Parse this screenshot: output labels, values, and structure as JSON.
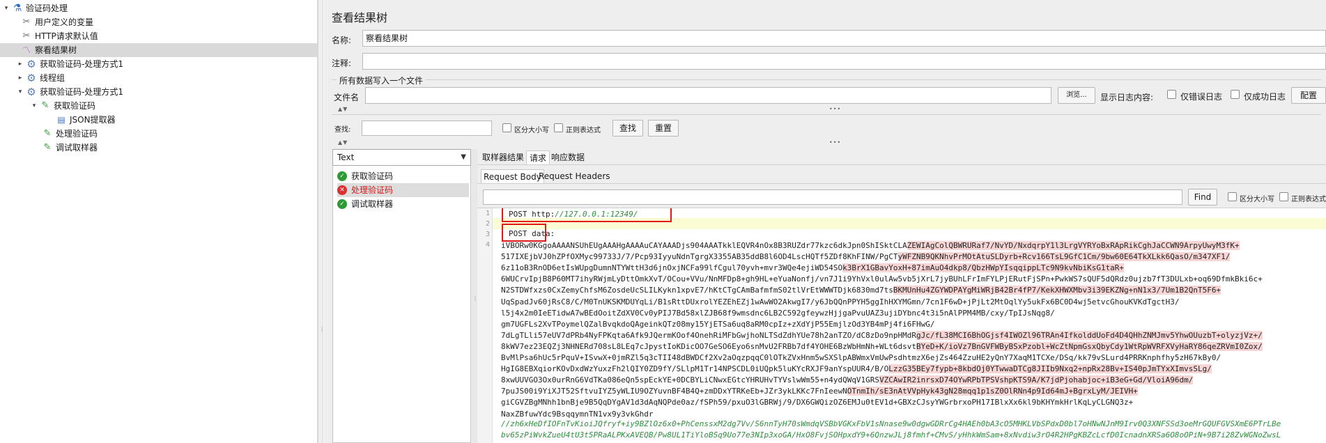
{
  "tree": {
    "items": [
      {
        "label": "验证码处理",
        "icon": "flask-icon",
        "expander": "▾"
      },
      {
        "label": "用户定义的变量",
        "icon": "wrench-icon",
        "expander": ""
      },
      {
        "label": "HTTP请求默认值",
        "icon": "wrench-icon",
        "expander": ""
      },
      {
        "label": "察看结果树",
        "icon": "chart-icon",
        "expander": ""
      },
      {
        "label": "获取验证码-处理方式1",
        "icon": "gear-icon",
        "expander": "▸"
      },
      {
        "label": "线程组",
        "icon": "gear-icon",
        "expander": "▸"
      },
      {
        "label": "获取验证码-处理方式1",
        "icon": "gear-icon",
        "expander": "▾"
      },
      {
        "label": "获取验证码",
        "icon": "pen-icon",
        "expander": "▾"
      },
      {
        "label": "JSON提取器",
        "icon": "doc-icon",
        "expander": ""
      },
      {
        "label": "处理验证码",
        "icon": "pen-icon",
        "expander": ""
      },
      {
        "label": "调试取样器",
        "icon": "pen-icon",
        "expander": ""
      }
    ]
  },
  "panel": {
    "title": "查看结果树",
    "name_label": "名称:",
    "name_value": "察看结果树",
    "comment_label": "注释:",
    "comment_value": "",
    "section_label": "所有数据写入一个文件",
    "file_label": "文件名",
    "file_value": "",
    "browse_label": "浏览...",
    "log_label": "显示日志内容:",
    "errors_only_label": "仅错误日志",
    "success_only_label": "仅成功日志",
    "config_label": "配置"
  },
  "search": {
    "label": "查找:",
    "value": "",
    "case_label": "区分大小写",
    "regex_label": "正则表达式",
    "find_label": "查找",
    "reset_label": "重置"
  },
  "renderer": {
    "selected": "Text"
  },
  "results": [
    {
      "label": "获取验证码",
      "status": "ok"
    },
    {
      "label": "处理验证码",
      "status": "error"
    },
    {
      "label": "调试取样器",
      "status": "ok"
    }
  ],
  "tabs": {
    "sampler": "取样器结果",
    "request": "请求",
    "response": "响应数据",
    "request_body": "Request Body",
    "request_headers": "Request Headers"
  },
  "code_search": {
    "value": "",
    "find_label": "Find",
    "case_label": "区分大小写",
    "regex_label": "正则表达式"
  },
  "code": {
    "line_numbers": [
      "1",
      "2",
      "3",
      "4"
    ],
    "line1_prefix": "POST http:",
    "line1_url": "//127.0.0.1:12349/",
    "line3": "POST data:",
    "body": [
      "iVBORw0KGgoAAAANSUhEUgAAAHgAAAAuCAYAAADjs904AAATkklEQVR4nOx8B3RUZdr77kzc6dkJpn0ShISktCLAZEWIAgColQBWRURaf7/NvYD/NxdqrpY1l3LrgVYRYoBxRApRikCghJaCCWN9ArpyUwyM3fK+",
      "517IXEjbVJ0hZPfOXMyc99733J/7/Pcp93IyyuNdnTgrgX3355AB35ddB8l6OD4LscHQTf5ZDf8KhFINW/PgCTyWFZNB9QKNhvPrMOtAtuSLDyrb+Rcv166TsL9GfC1Cm/9bw60E64TkXLkk6QasO/m347XF1/",
      "6z11oB3RnOD6etIsWUpgDumnNTYWttH3d6jnOxjNCFa99lfCgul70yvh+mvr3WQe4ejiWD54SOk3BrX1GBavYoxH+87imAuO4dkp8/QbzHWpYIsqqippLTc9N9kvNbiKsG1taR+",
      "6WUCrvIpjB8P60MT7ihyRWjmLyDttOmkXvT/OCou+VVu/NnMFDp8+gh9HL+eYuaNonfj/vn7J1i9YhVxl0ulAw5vb5jXrL7jyBUhLFrImFYLPjERutFjSPn+PwkWS7sQUF5dQRdz0ujzb7fT3DULxb+oq69DfmkBki6c+",
      "N2STDWfxzs0CxZemyChfsM6ZosdeUcSLILKykn1xpvE7/hKtCTgCAmBafmfmS02tlVrEtWWWTDjk6830md7tsBKMUnHu4ZGYWDPAYgMiWRjB42Br4fP7/KekXHWXMbv3i39EKZNg+nN1x3/7Um1B2QnT5F6+",
      "UqSpadJv60jRsC8/C/M0TnUKSKMDUYqLi/B1sRttDUxrolYEZEhEZj1wAwWO2AkwgI7/y6JbQQnPPYH5ggIhHXYMGmn/7cn1F6wD+jPjLt2MtOqlYy5ukFx6BC0D4wj5etvcGhouKVKdTgctH3/",
      "l5j4x2m0IeETidwA7wBEdOoitZdXV0Cv0yPIJ7Bd58xlZJB68f9wmsdnc6LB2C592gfeywzHjjgaPvuUAZ3ujiDYbnc4t3i5nAlPPM4MB/cxy/TpIJsNqg8/",
      "gm7UGFLs2XvTPoymelQZalBvqkdoQAgeinkQTz08my15YjETSa6uq8aRM0cpIz+zXdYjP55EmjlzOd3YB4mPj4fi6FHwG/",
      "7dLgTLli57eUV7dPRb4NyFPKqta6Afk9JQermKOof4OnehRiMFbGwjhoNLTSdZdhYUe78h2anTZO/dC8zDo9npHMdRgJc/fL38MCI6BhOGjsf4IWOZl96TRAn4IfkolddUoFd4D4QHhZNMJmv5YhwOUuzbT+olyzjVz+/",
      "8kWV7ez23EQZj3NHNERd708sL8LEq7cJpystIoKDicOO7GeSO6Eyo6snMvU2FRBb7df4YOHE6BzWbHmNh+WLt6dsvtBYeD+K/ioVz7BnGVFWByBSxPzobl+WcZtNpmGsxQbyCdy1WtRpWVRFXVyHaRY86qeZRVmI0Zox/",
      "BvMlPsa6hUc5rPquV+ISvwX+0jmRZl5q3cTII48dBWDCf2Xv2aOqzpqqC0lOTkZVxHnm5wSXSlpABWmxVmUwPsdhtmzX6ejZs464ZzuHE2yQnY7XaqM1TCXe/DSq/kk79vSLurd4PRRKnphfhy5zH67kBy0/",
      "HgIG8EBXqiorKOvDxdWzYuxzFh2lQIY0ZD9fY/SLlpM1Tr14NPSCDL0iUQpk5luKYcRXJF9anYspUUR4/B/OLzzG35BEy7fypb+8kbdOj0YTwwaDTCg8JIIb9Nxq2+npRx28Bv+IS40pJmTYxXImvsSLg/",
      "8xwUUVGO3Ox0urRnG6VdTKa086eQn5spEckYE+0DCBYLiCNwxEGtcYHRUHvTYVslwWm55+n4ydQWqV1GRSVZCAwIR2inrsxD74OYwRPbTPSVshpKTS9A/K7jdPjohabjoc+iB3eG+Gd/VloiA96dm/",
      "7puJS00i9YiXJT52SftvuIYZ5yWLIU9OZYuvnBF4B4Q+zmDDxYTRKeEb+JZr3ykLKKc7FnIeewNOTnmIh/sE3nAtVVpHyk43gN28mqq1p1sZ0OlRNn4p9Id64mJ+BgrxLyM/JEIVH+",
      "giCGVZBgMNhh1bnBje9B5QqDYgAV1d3dAqNQPde0az/fSPh59/pxuO3lGBRWj/9/DX6GWQizOZ6EMJu0tEV1d+GBXzCJsyYWGrbrxoPH17IBlxXx6kl9bKHYmkHrlKqLyCLGNQ3z+",
      "NaxZBfuwYdc9BsqqymnTN1vx9y3vkGhdr"
    ],
    "tail1": "//zh6xHeDfIOFnTvKioiJQfryf+iy9BZlOz6x0+PhCenssxM2dg7Vv/S6nnTyH70sWmdqVSBbVGKxFbV1sNnase9w0dgwGDRrCg4HAEh0bA3cO5MHKLVbSPdxD0bl7oHNwNJnM9Irv0Q3XNFSSd3oeMrGQUFGVSXmE6PTrLBe",
    "tail2": "bv65zPiWvkZueU4tU3t5PRaALPKxAVEQB/Pw8UL1TiYloBSq9Uo77e3NIp3xoGA/HxO8FvjSOHpxdY9+6QnzwJLj8fmhf+CMvS/yHhkWmSam+8xNvdiw3rO4R2HPgKBZcLcfD0IcnadnXRSa6O8oOPiN+9B7i28ZvWGNoZwsL"
  }
}
